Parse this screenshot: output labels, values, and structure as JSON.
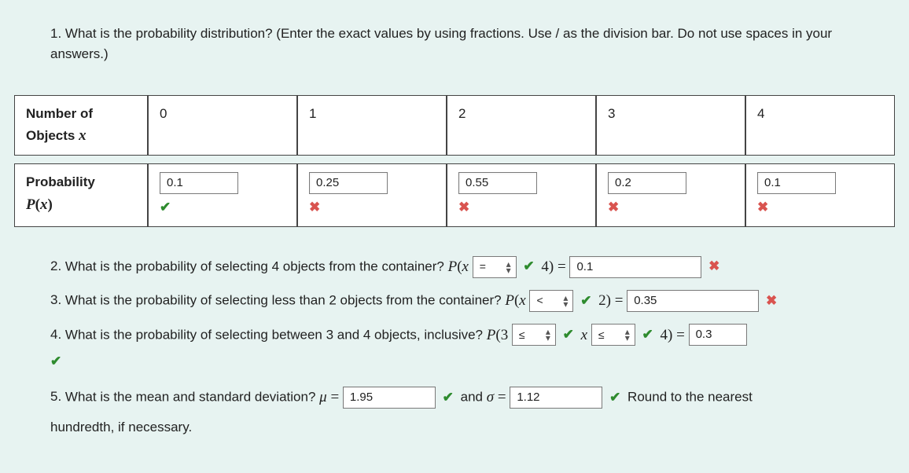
{
  "q1": {
    "number_label": "1.",
    "text": "What is the probability distribution? (Enter the exact values by using fractions. Use / as the division bar. Do not use spaces in your answers.)"
  },
  "table": {
    "row1_header_line1": "Number of",
    "row1_header_line2": "Objects",
    "row1_var": "x",
    "xvals": [
      "0",
      "1",
      "2",
      "3",
      "4"
    ],
    "row2_header_line1": "Probability",
    "row2_header_P": "P",
    "row2_header_x": "x",
    "pvals": [
      "0.1",
      "0.25",
      "0.55",
      "0.2",
      "0.1"
    ],
    "pmarks": [
      "check",
      "cross",
      "cross",
      "cross",
      "cross"
    ]
  },
  "q2": {
    "number_label": "2.",
    "text": "What is the probability of selecting 4 objects from the container?",
    "P": "P",
    "x": "x",
    "sel_val": "=",
    "after_sel": "4) =",
    "input": "0.1",
    "mark_sel": "check",
    "mark_input": "cross"
  },
  "q3": {
    "number_label": "3.",
    "text": "What is the probability of selecting less than 2 objects from the container?",
    "P": "P",
    "x": "x",
    "sel_val": "<",
    "after_sel": "2) =",
    "input": "0.35",
    "mark_sel": "check",
    "mark_input": "cross"
  },
  "q4": {
    "number_label": "4.",
    "text": "What is the probability of selecting between 3 and 4 objects, inclusive?",
    "P": "P",
    "three": "3",
    "sel1_val": "≤",
    "mark_sel1": "check",
    "mid_x": "x",
    "sel2_val": "≤",
    "mark_sel2": "check",
    "after_sel": "4) =",
    "input": "0.3",
    "mark_input": "check"
  },
  "q5": {
    "number_label": "5.",
    "text_a": "What is the mean and standard deviation?",
    "mu": "μ",
    "eq1": " = ",
    "input_mu": "1.95",
    "mark_mu": "check",
    "and": "and",
    "sigma": "σ",
    "eq2": " = ",
    "input_sigma": "1.12",
    "mark_sigma": "check",
    "tail_a": "Round to the nearest",
    "tail_b": "hundredth, if necessary."
  },
  "icons": {
    "check": "✔",
    "cross": "✖",
    "updown_up": "▴",
    "updown_down": "▾"
  }
}
